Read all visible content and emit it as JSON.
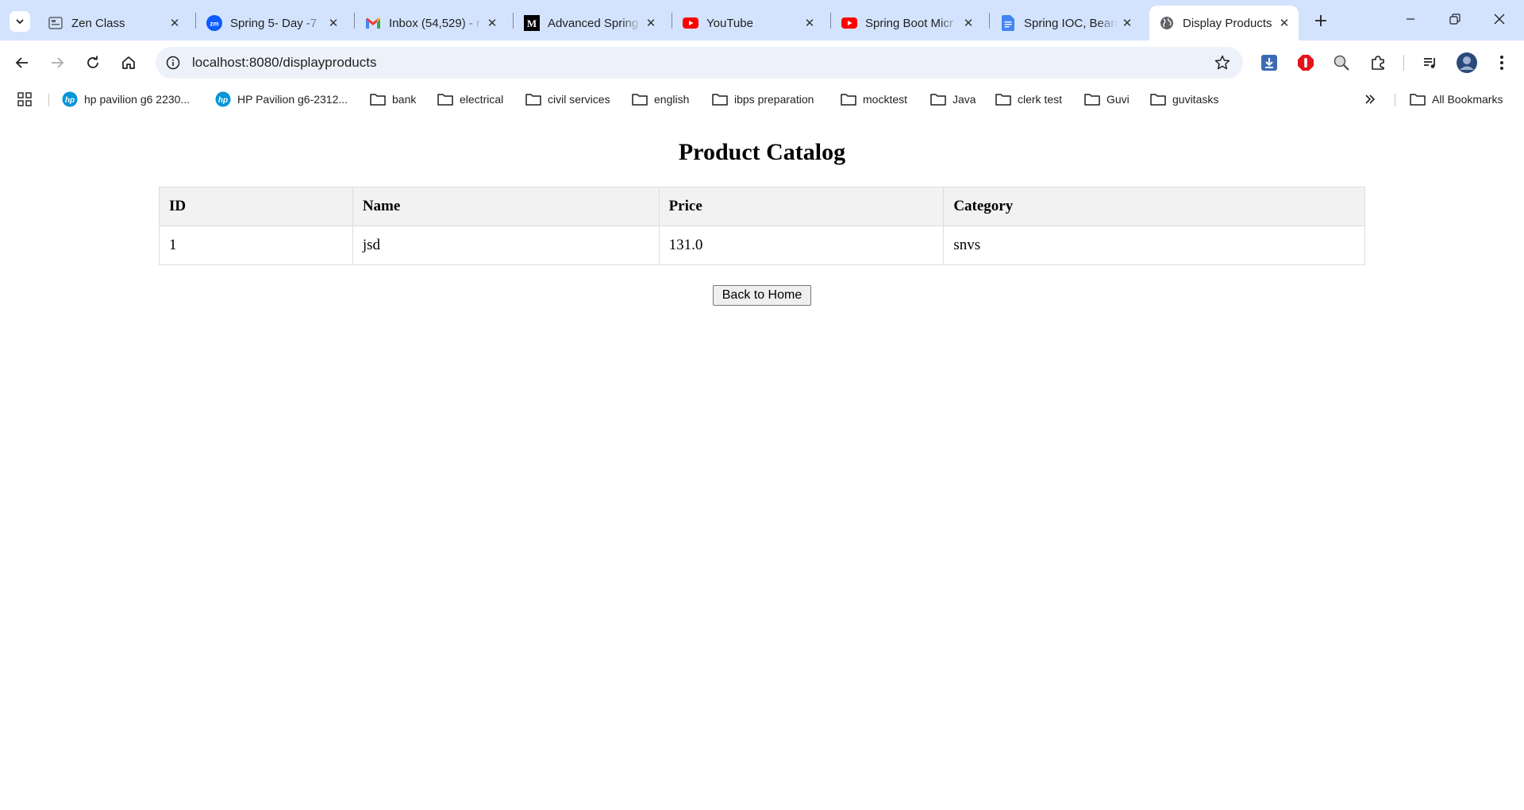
{
  "tabs": [
    {
      "title": "Zen Class",
      "icon": "zen-class-icon"
    },
    {
      "title": "Spring 5- Day -7",
      "icon": "zoom-icon"
    },
    {
      "title": "Inbox (54,529) - r",
      "icon": "gmail-icon"
    },
    {
      "title": "Advanced Spring",
      "icon": "medium-icon"
    },
    {
      "title": "YouTube",
      "icon": "youtube-icon"
    },
    {
      "title": "Spring Boot Micr",
      "icon": "youtube-icon"
    },
    {
      "title": "Spring IOC, Bean",
      "icon": "google-docs-icon"
    },
    {
      "title": "Display Products",
      "icon": "globe-icon",
      "active": true
    }
  ],
  "address_bar": {
    "url": "localhost:8080/displayproducts"
  },
  "bookmarks": [
    {
      "label": "hp pavilion g6 2230...",
      "type": "hp"
    },
    {
      "label": "HP Pavilion g6-2312...",
      "type": "hp"
    },
    {
      "label": "bank",
      "type": "folder"
    },
    {
      "label": "electrical",
      "type": "folder"
    },
    {
      "label": "civil services",
      "type": "folder"
    },
    {
      "label": "english",
      "type": "folder"
    },
    {
      "label": "ibps preparation",
      "type": "folder"
    },
    {
      "label": "mocktest",
      "type": "folder"
    },
    {
      "label": "Java",
      "type": "folder"
    },
    {
      "label": "clerk test",
      "type": "folder"
    },
    {
      "label": "Guvi",
      "type": "folder"
    },
    {
      "label": "guvitasks",
      "type": "folder"
    }
  ],
  "all_bookmarks_label": "All Bookmarks",
  "page": {
    "title": "Product Catalog",
    "table": {
      "headers": [
        "ID",
        "Name",
        "Price",
        "Category"
      ],
      "rows": [
        [
          "1",
          "jsd",
          "131.0",
          "snvs"
        ]
      ]
    },
    "back_button_label": "Back to Home"
  },
  "colors": {
    "tab_strip_bg": "#d3e3fd",
    "omnibox_bg": "#edf2fa",
    "header_row_bg": "#f2f2f2",
    "table_border": "#dddddd"
  }
}
